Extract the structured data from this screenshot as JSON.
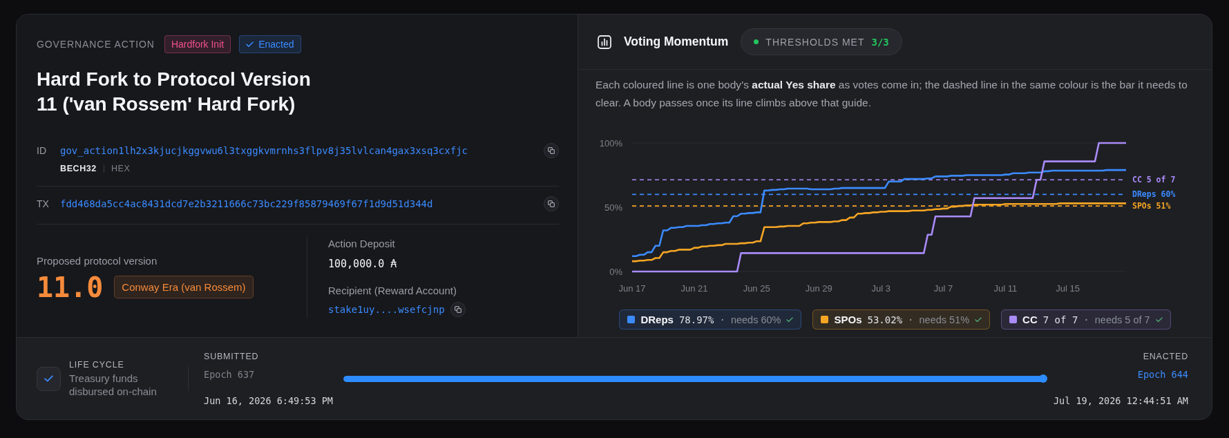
{
  "governance_action": {
    "eyebrow": "GOVERNANCE ACTION",
    "tags": [
      {
        "label": "Hardfork Init",
        "kind": "type",
        "color": "#f0508c"
      },
      {
        "label": "Enacted",
        "kind": "status",
        "color": "#3b8bff"
      }
    ],
    "title": "Hard Fork to Protocol Version 11 ('van Rossem' Hard Fork)",
    "identifiers": [
      {
        "label": "ID",
        "value": "gov_action1lh2x3kjucjkggvwu6l3txggkvmrnhs3flpv8j35lvlcan4gax3xsq3cxfjc",
        "formats": [
          {
            "label": "BECH32",
            "selected": true
          },
          {
            "label": "HEX",
            "selected": false
          }
        ]
      },
      {
        "label": "TX",
        "value": "fdd468da5cc4ac8431dcd7e2b3211666c73bc229f85879469f67f1d9d51d344d"
      }
    ],
    "protocol": {
      "label": "Proposed protocol version",
      "version": "11.0",
      "era": "Conway Era (van Rossem)"
    },
    "deposit": {
      "label": "Action Deposit",
      "value": "100,000.0 ₳"
    },
    "recipient": {
      "label": "Recipient (Reward Account)",
      "value": "stake1uy....wsefcjnp"
    }
  },
  "voting_momentum": {
    "title": "Voting Momentum",
    "status": {
      "label": "THRESHOLDS MET",
      "count": "3/3"
    },
    "description": "Each coloured line is one body’s **actual Yes share** as votes come in; the dashed line in the same colour is the bar it needs to clear. A body passes once its line climbs above that guide.",
    "chart_data": {
      "type": "line",
      "categories": [
        "Jun 17",
        null,
        null,
        null,
        null,
        null,
        null,
        null,
        null,
        null,
        null,
        null,
        null,
        null,
        null,
        null,
        "Jun 21",
        null,
        null,
        null,
        null,
        null,
        null,
        null,
        null,
        null,
        null,
        null,
        null,
        null,
        null,
        null,
        "Jun 25",
        null,
        null,
        null,
        null,
        null,
        null,
        null,
        null,
        null,
        null,
        null,
        null,
        null,
        null,
        null,
        "Jun 29",
        null,
        null,
        null,
        null,
        null,
        null,
        null,
        null,
        null,
        null,
        null,
        null,
        null,
        null,
        null,
        "Jul 3",
        null,
        null,
        null,
        null,
        null,
        null,
        null,
        null,
        null,
        null,
        null,
        null,
        null,
        null,
        null,
        "Jul 7",
        null,
        null,
        null,
        null,
        null,
        null,
        null,
        null,
        null,
        null,
        null,
        null,
        null,
        null,
        null,
        "Jul 11",
        null,
        null,
        null,
        null,
        null,
        null,
        null,
        null,
        null,
        null,
        null,
        null,
        null,
        null,
        null,
        "Jul 15",
        null,
        null,
        null,
        null,
        null,
        null,
        null,
        null,
        null,
        null,
        null,
        null,
        null,
        null,
        null
      ],
      "series": [
        {
          "name": "DReps",
          "color": "#3b8bff",
          "values": [
            12,
            12,
            13,
            13,
            15,
            15,
            20,
            20,
            32,
            32,
            34,
            34,
            34.5,
            34.5,
            35.5,
            35.5,
            35.5,
            35.5,
            36,
            36,
            37,
            37,
            37.5,
            37.5,
            38,
            38,
            43,
            43,
            45,
            45,
            45.5,
            45.5,
            46,
            46,
            63,
            63,
            63.5,
            63.5,
            64,
            64,
            64.5,
            64.5,
            64.5,
            64.5,
            64.5,
            64.5,
            64,
            64,
            64,
            64,
            64,
            64,
            64.5,
            64.5,
            65,
            65,
            65,
            65,
            65,
            65,
            65,
            65,
            65,
            65,
            65,
            65,
            70,
            70,
            70,
            70,
            72,
            72,
            72,
            72,
            72,
            72,
            72.5,
            72.5,
            74,
            74,
            74,
            74,
            74.5,
            74.5,
            74.5,
            74.5,
            75,
            75,
            75,
            75,
            75,
            75,
            75,
            75,
            75,
            75,
            75.5,
            75.5,
            76.5,
            76.5,
            76.5,
            76.5,
            77,
            77,
            77,
            77,
            78,
            78,
            78.5,
            78.5,
            78.5,
            78.5,
            78.5,
            78.5,
            78.5,
            78.5,
            78.5,
            78.5,
            78.5,
            78.5,
            78.5,
            78.5,
            79,
            79,
            79,
            79,
            79,
            79
          ]
        },
        {
          "name": "SPOs",
          "color": "#f5a524",
          "values": [
            8,
            8,
            8.5,
            8.5,
            9,
            9,
            10.5,
            10.5,
            15,
            15,
            16,
            16,
            17,
            17,
            17,
            17,
            18.5,
            18.5,
            19.5,
            19.5,
            20,
            20,
            20.5,
            20.5,
            21.5,
            21.5,
            21.5,
            21.5,
            22,
            22,
            22.5,
            22.5,
            23.5,
            23.5,
            34.5,
            34.5,
            34.5,
            34.5,
            35,
            35,
            35.5,
            35.5,
            35.5,
            35.5,
            37.5,
            37.5,
            38,
            38,
            38.5,
            38.5,
            38.5,
            38.5,
            39,
            39,
            40,
            40,
            42,
            42,
            45,
            45,
            45.5,
            45.5,
            46,
            46,
            46.5,
            46.5,
            47,
            47,
            47,
            47,
            47,
            47,
            47.5,
            47.5,
            47.5,
            47.5,
            48,
            48,
            48.5,
            48.5,
            49,
            49,
            50.5,
            50.5,
            51,
            51,
            51.5,
            51.5,
            52,
            52,
            52,
            52,
            52,
            52,
            52,
            52,
            52.5,
            52.5,
            52.5,
            52.5,
            52.5,
            52.5,
            52.5,
            52.5,
            52.5,
            52.5,
            52.5,
            52.5,
            52.5,
            52.5,
            53,
            53,
            53,
            53,
            53,
            53,
            53,
            53,
            53,
            53,
            53,
            53,
            53,
            53,
            53,
            53,
            53,
            53
          ]
        },
        {
          "name": "CC",
          "color": "#a98bfa",
          "values": [
            0,
            0,
            0,
            0,
            0,
            0,
            0,
            0,
            0,
            0,
            0,
            0,
            0,
            0,
            0,
            0,
            0,
            0,
            0,
            0,
            0,
            0,
            0,
            0,
            0,
            0,
            0,
            0,
            14.3,
            14.3,
            14.3,
            14.3,
            14.3,
            14.3,
            14.3,
            14.3,
            14.3,
            14.3,
            14.3,
            14.3,
            14.3,
            14.3,
            14.3,
            14.3,
            14.3,
            14.3,
            14.3,
            14.3,
            14.3,
            14.3,
            14.3,
            14.3,
            14.3,
            14.3,
            14.3,
            14.3,
            14.3,
            14.3,
            14.3,
            14.3,
            14.3,
            14.3,
            14.3,
            14.3,
            14.3,
            14.3,
            14.3,
            14.3,
            14.3,
            14.3,
            14.3,
            14.3,
            14.3,
            14.3,
            14.3,
            14.3,
            28.6,
            28.6,
            42.9,
            42.9,
            42.9,
            42.9,
            42.9,
            42.9,
            42.9,
            42.9,
            42.9,
            42.9,
            57.1,
            57.1,
            57.1,
            57.1,
            57.1,
            57.1,
            57.1,
            57.1,
            57.1,
            57.1,
            57.1,
            57.1,
            57.1,
            57.1,
            57.1,
            57.1,
            71.4,
            71.4,
            85.7,
            85.7,
            85.7,
            85.7,
            85.7,
            85.7,
            85.7,
            85.7,
            85.7,
            85.7,
            85.7,
            85.7,
            85.7,
            85.7,
            100,
            100,
            100,
            100,
            100,
            100,
            100,
            100
          ]
        }
      ],
      "ylim": [
        0,
        100
      ],
      "yticks": [
        {
          "value": 0,
          "label": "0%"
        },
        {
          "value": 50,
          "label": "50%"
        },
        {
          "value": 100,
          "label": "100%"
        }
      ],
      "ref_lines": [
        {
          "axis": "y",
          "value": 71.4,
          "label": "CC 5 of 7",
          "color": "#a98bfa"
        },
        {
          "axis": "y",
          "value": 60,
          "label": "DReps 60%",
          "color": "#3b8bff"
        },
        {
          "axis": "y",
          "value": 51,
          "label": "SPOs 51%",
          "color": "#f5a524"
        }
      ]
    },
    "legend": [
      {
        "share": "78.97%",
        "separator": "·",
        "needs": "needs 60%",
        "met": true
      },
      {
        "share": "53.02%",
        "separator": "·",
        "needs": "needs 51%",
        "met": true
      },
      {
        "share": "7 of 7",
        "separator": "·",
        "needs": "needs 5 of 7",
        "met": true
      }
    ]
  },
  "life_cycle": {
    "label": "LIFE CYCLE",
    "description": "Treasury funds disbursed on-chain",
    "start": {
      "label": "SUBMITTED",
      "epoch": "Epoch 637",
      "linked": false,
      "date": "Jun 16, 2026 6:49:53 PM"
    },
    "end": {
      "label": "ENACTED",
      "epoch": "Epoch 644",
      "linked": true,
      "date": "Jul 19, 2026 12:44:51 AM"
    },
    "level": 1
  }
}
